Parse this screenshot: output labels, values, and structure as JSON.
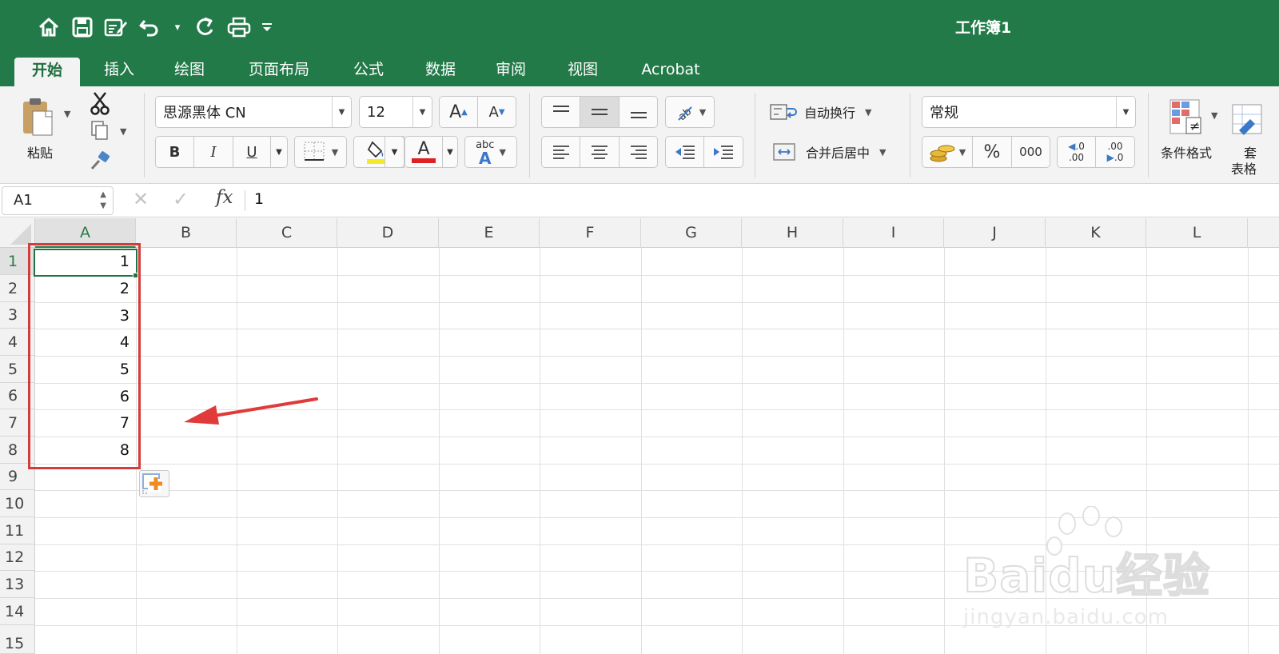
{
  "window": {
    "title": "工作簿1"
  },
  "qat": {
    "items": [
      "home-icon",
      "save-icon",
      "edit-document-icon",
      "undo-icon",
      "redo-icon",
      "print-icon",
      "customize-icon"
    ]
  },
  "tabs": [
    {
      "label": "开始",
      "active": true
    },
    {
      "label": "插入"
    },
    {
      "label": "绘图"
    },
    {
      "label": "页面布局"
    },
    {
      "label": "公式"
    },
    {
      "label": "数据"
    },
    {
      "label": "审阅"
    },
    {
      "label": "视图"
    },
    {
      "label": "Acrobat"
    }
  ],
  "ribbon": {
    "paste_label": "粘贴",
    "font_name": "思源黑体 CN",
    "font_size": "12",
    "bold_label": "B",
    "italic_label": "I",
    "underline_label": "U",
    "increase_font_label": "A",
    "decrease_font_label": "A",
    "font_color_label": "A",
    "phonetic_label_top": "abc",
    "phonetic_label_bottom": "A",
    "wrap_text_label": "自动换行",
    "merge_center_label": "合并后居中",
    "number_format": "常规",
    "percent_label": "%",
    "comma_label": "000",
    "inc_decimal_top": ".0",
    "inc_decimal_bottom": ".00",
    "dec_decimal_top": ".00",
    "dec_decimal_bottom": ".0",
    "conditional_format_label": "条件格式",
    "table_format_label_partial": "表格",
    "table_format_top_partial": "套",
    "highlight_color": "#f5ea2a",
    "font_color": "#e02020"
  },
  "formula_bar": {
    "name_box": "A1",
    "fx_label": "fx",
    "value": "1"
  },
  "sheet": {
    "columns": [
      "A",
      "B",
      "C",
      "D",
      "E",
      "F",
      "G",
      "H",
      "I",
      "J",
      "K",
      "L"
    ],
    "selected_column": "A",
    "rows": [
      "1",
      "2",
      "3",
      "4",
      "5",
      "6",
      "7",
      "8",
      "9",
      "10",
      "11",
      "12",
      "13",
      "14",
      "15"
    ],
    "selected_row": "1",
    "column_a_values": [
      "1",
      "2",
      "3",
      "4",
      "5",
      "6",
      "7",
      "8"
    ],
    "active_cell": "A1"
  },
  "annotation": {
    "highlight_color": "#d43b3b"
  },
  "watermark": {
    "brand": "Baidu经验",
    "url": "jingyan.baidu.com"
  }
}
